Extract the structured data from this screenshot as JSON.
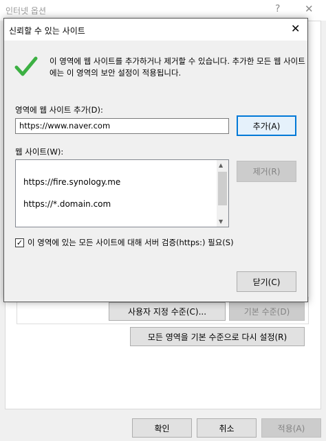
{
  "background_window": {
    "title": "인터넷 옵션",
    "help_glyph": "?",
    "close_glyph": "✕",
    "custom_level_button": "사용자 지정 수준(C)...",
    "default_level_button": "기본 수준(D)",
    "reset_all_zones_button": "모든 영역을 기본 수준으로 다시 설정(R)",
    "ok_button": "확인",
    "cancel_button": "취소",
    "apply_button": "적용(A)"
  },
  "dialog": {
    "title": "신뢰할 수 있는 사이트",
    "close_glyph": "✕",
    "info_icon": "checkmark-icon",
    "info_text": "이 영역에 웹 사이트를 추가하거나 제거할 수 있습니다. 추가한 모든 웹 사이트에는 이 영역의 보안 설정이 적용됩니다.",
    "add_label": "영역에 웹 사이트 추가(D):",
    "add_input_value": "https://www.naver.com",
    "add_button": "추가(A)",
    "sites_label": "웹 사이트(W):",
    "sites": [
      "https://fire.synology.me",
      "https://*.domain.com"
    ],
    "remove_button": "제거(R)",
    "require_https_label": "이 영역에 있는 모든 사이트에 대해 서버 검증(https:) 필요(S)",
    "require_https_checked": true,
    "close_button": "닫기(C)"
  },
  "colors": {
    "checkmark": "#3cb043",
    "accent": "#0078d7"
  }
}
